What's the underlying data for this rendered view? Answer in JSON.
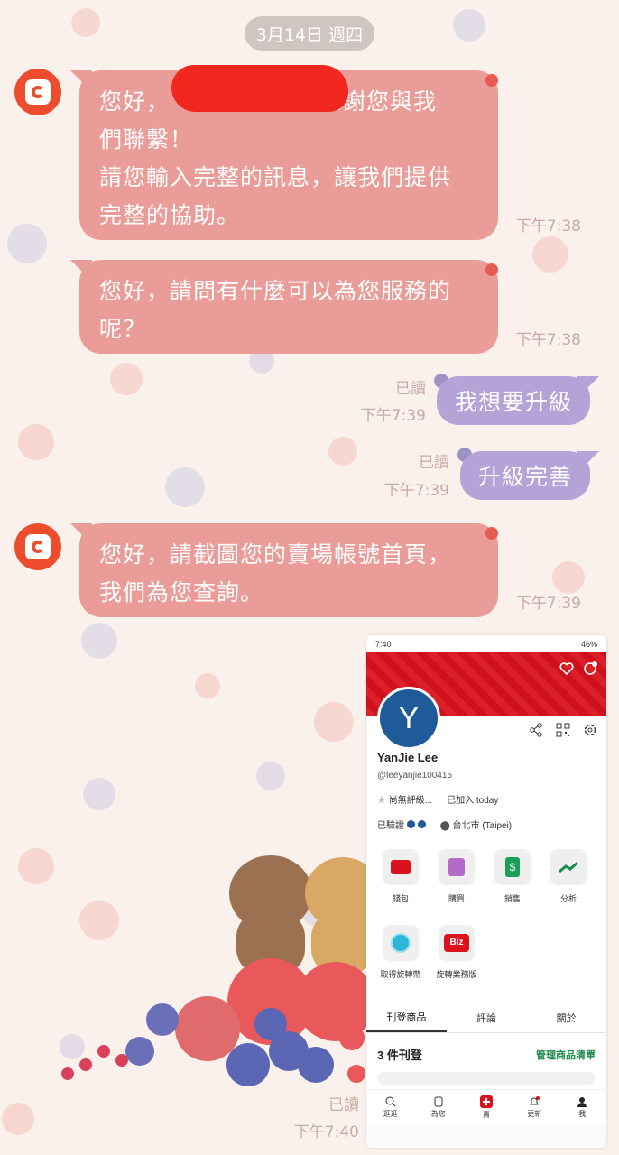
{
  "chat": {
    "date_label": "3月14日 週四",
    "messages": [
      {
        "from": "shop",
        "lines": [
          "您好，",
          "感謝您與我",
          "們聯繫！",
          "請您輸入完整的訊息，讓我們提供",
          "完整的協助。"
        ],
        "time": "下午7:38"
      },
      {
        "from": "shop",
        "lines": [
          "您好，請問有什麼可以為您服務的",
          "呢？"
        ],
        "time": "下午7:38"
      },
      {
        "from": "me",
        "text": "我想要升級",
        "read": "已讀",
        "time": "下午7:39"
      },
      {
        "from": "me",
        "text": "升級完善",
        "read": "已讀",
        "time": "下午7:39"
      },
      {
        "from": "shop",
        "lines": [
          "您好，請截圖您的賣場帳號首頁，",
          "我們為您查詢。"
        ],
        "time": "下午7:39"
      },
      {
        "from": "me",
        "type": "image",
        "read": "已讀",
        "time": "下午7:40"
      }
    ]
  },
  "screenshot": {
    "status_time": "7:40",
    "status_battery": "46%",
    "avatar_letter": "Y",
    "name": "YanJie Lee",
    "handle": "@leeyanjie100415",
    "rating": "尚無評級...",
    "joined": "已加入 today",
    "verified": "已驗證",
    "location": "台北市 (Taipei)",
    "grid_items": [
      {
        "label": "錢包",
        "icon": "wallet-icon"
      },
      {
        "label": "購買",
        "icon": "shopping-bag-icon"
      },
      {
        "label": "銷售",
        "icon": "dollar-tag-icon"
      },
      {
        "label": "分析",
        "icon": "chart-icon"
      },
      {
        "label": "取得旋轉幣",
        "icon": "coin-icon"
      },
      {
        "label": "旋轉業務版",
        "icon": "biz-icon",
        "badge": "Biz"
      }
    ],
    "tabs": [
      "刊登商品",
      "評論",
      "關於"
    ],
    "listing_count": "3 件刊登",
    "manage_link": "管理商品清單",
    "nav": [
      {
        "label": "逛逛",
        "icon": "search-icon"
      },
      {
        "label": "為您",
        "icon": "for-you-icon"
      },
      {
        "label": "賣",
        "icon": "sell-plus-icon"
      },
      {
        "label": "更新",
        "icon": "bell-icon"
      },
      {
        "label": "我",
        "icon": "profile-icon"
      }
    ],
    "colors": {
      "banner": "#d9121d",
      "manage": "#1b8b4b",
      "avatar": "#1f5a99"
    }
  },
  "colors": {
    "incoming_bubble": "#ea9c98",
    "outgoing_bubble": "#b5a3d7",
    "background": "#fbf1ec"
  }
}
